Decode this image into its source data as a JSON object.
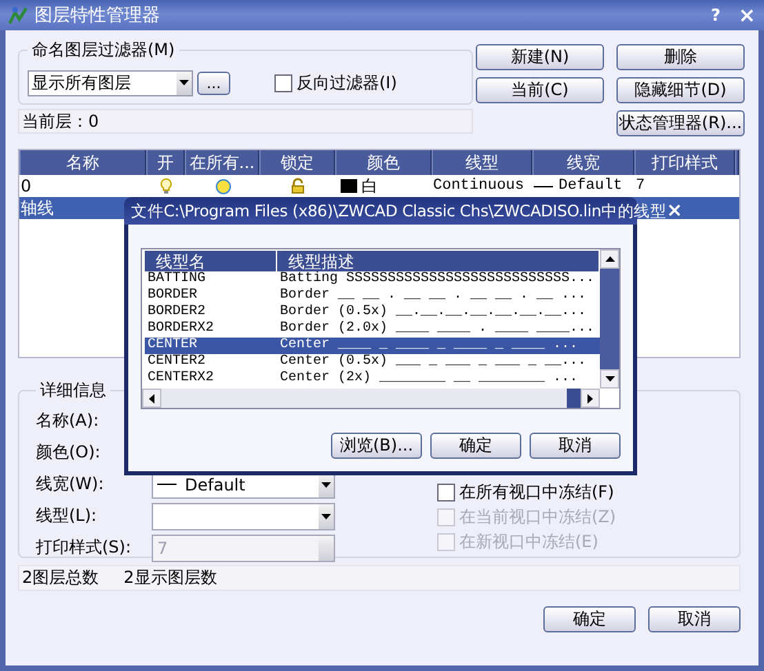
{
  "window": {
    "title": "图层特性管理器",
    "help": "?",
    "close": "×"
  },
  "filter": {
    "label": "命名图层过滤器(M)",
    "value": "显示所有图层",
    "more_button": "...",
    "invert": {
      "label": "反向过滤器(I)",
      "checked": false
    }
  },
  "current_layer": "当前层：0",
  "buttons": [
    "新建(N)",
    "删除",
    "当前(C)",
    "隐藏细节(D)",
    "状态管理器(R)..."
  ],
  "layers": {
    "columns": [
      "名称",
      "开",
      "在所有...",
      "锁定",
      "颜色",
      "线型",
      "线宽",
      "打印样式"
    ],
    "rows": [
      {
        "name": "0",
        "selected": false,
        "color": "#000000",
        "color_label": "白",
        "linetype": "Continuous",
        "lineweight": "Default",
        "plot_style": "7"
      },
      {
        "name": "轴线",
        "selected": true
      }
    ]
  },
  "details": {
    "title": "详细信息",
    "fields": [
      {
        "label": "名称(A):",
        "kind": "covered"
      },
      {
        "label": "颜色(O):",
        "kind": "covered"
      },
      {
        "label": "线宽(W):",
        "kind": "combo",
        "value": "Default"
      },
      {
        "label": "线型(L):",
        "kind": "combo"
      },
      {
        "label": "打印样式(S):",
        "kind": "disabled",
        "value": "7"
      }
    ],
    "checkboxes": [
      {
        "label": "在所有视口中冻结(F)",
        "checked": false,
        "disabled": false
      },
      {
        "label": "在当前视口中冻结(Z)",
        "checked": false,
        "disabled": true
      },
      {
        "label": "在新视口中冻结(E)",
        "checked": false,
        "disabled": true
      }
    ]
  },
  "status_bar": [
    "2图层总数",
    "2显示图层数"
  ],
  "footer_buttons": [
    "确定",
    "取消"
  ],
  "dialog": {
    "title": "文件C:\\Program Files (x86)\\ZWCAD Classic Chs\\ZWCADISO.lin中的线型",
    "close": "×",
    "columns": [
      "线型名",
      "线型描述"
    ],
    "rows": [
      {
        "name": "BATTING",
        "description": "Batting SSSSSSSSSSSSSSSSSSSSSSSSSSS...",
        "selected": false
      },
      {
        "name": "BORDER",
        "description": "Border __ __ . __ __ . __ __ . __ ...",
        "selected": false
      },
      {
        "name": "BORDER2",
        "description": "Border (0.5x) __.__.__.__.__.__.__...",
        "selected": false
      },
      {
        "name": "BORDERX2",
        "description": "Border (2.0x) ____ ____ . ____ ____...",
        "selected": false
      },
      {
        "name": "CENTER",
        "description": "Center ____ _ ____ _ ____ _ ____ ...",
        "selected": true
      },
      {
        "name": "CENTER2",
        "description": "Center (0.5x) ___ _ ___ _ ___ _ __...",
        "selected": false
      },
      {
        "name": "CENTERX2",
        "description": "Center (2x) ________ __ ________ ...",
        "selected": false
      }
    ],
    "buttons": [
      "浏览(B)...",
      "确定",
      "取消"
    ]
  }
}
